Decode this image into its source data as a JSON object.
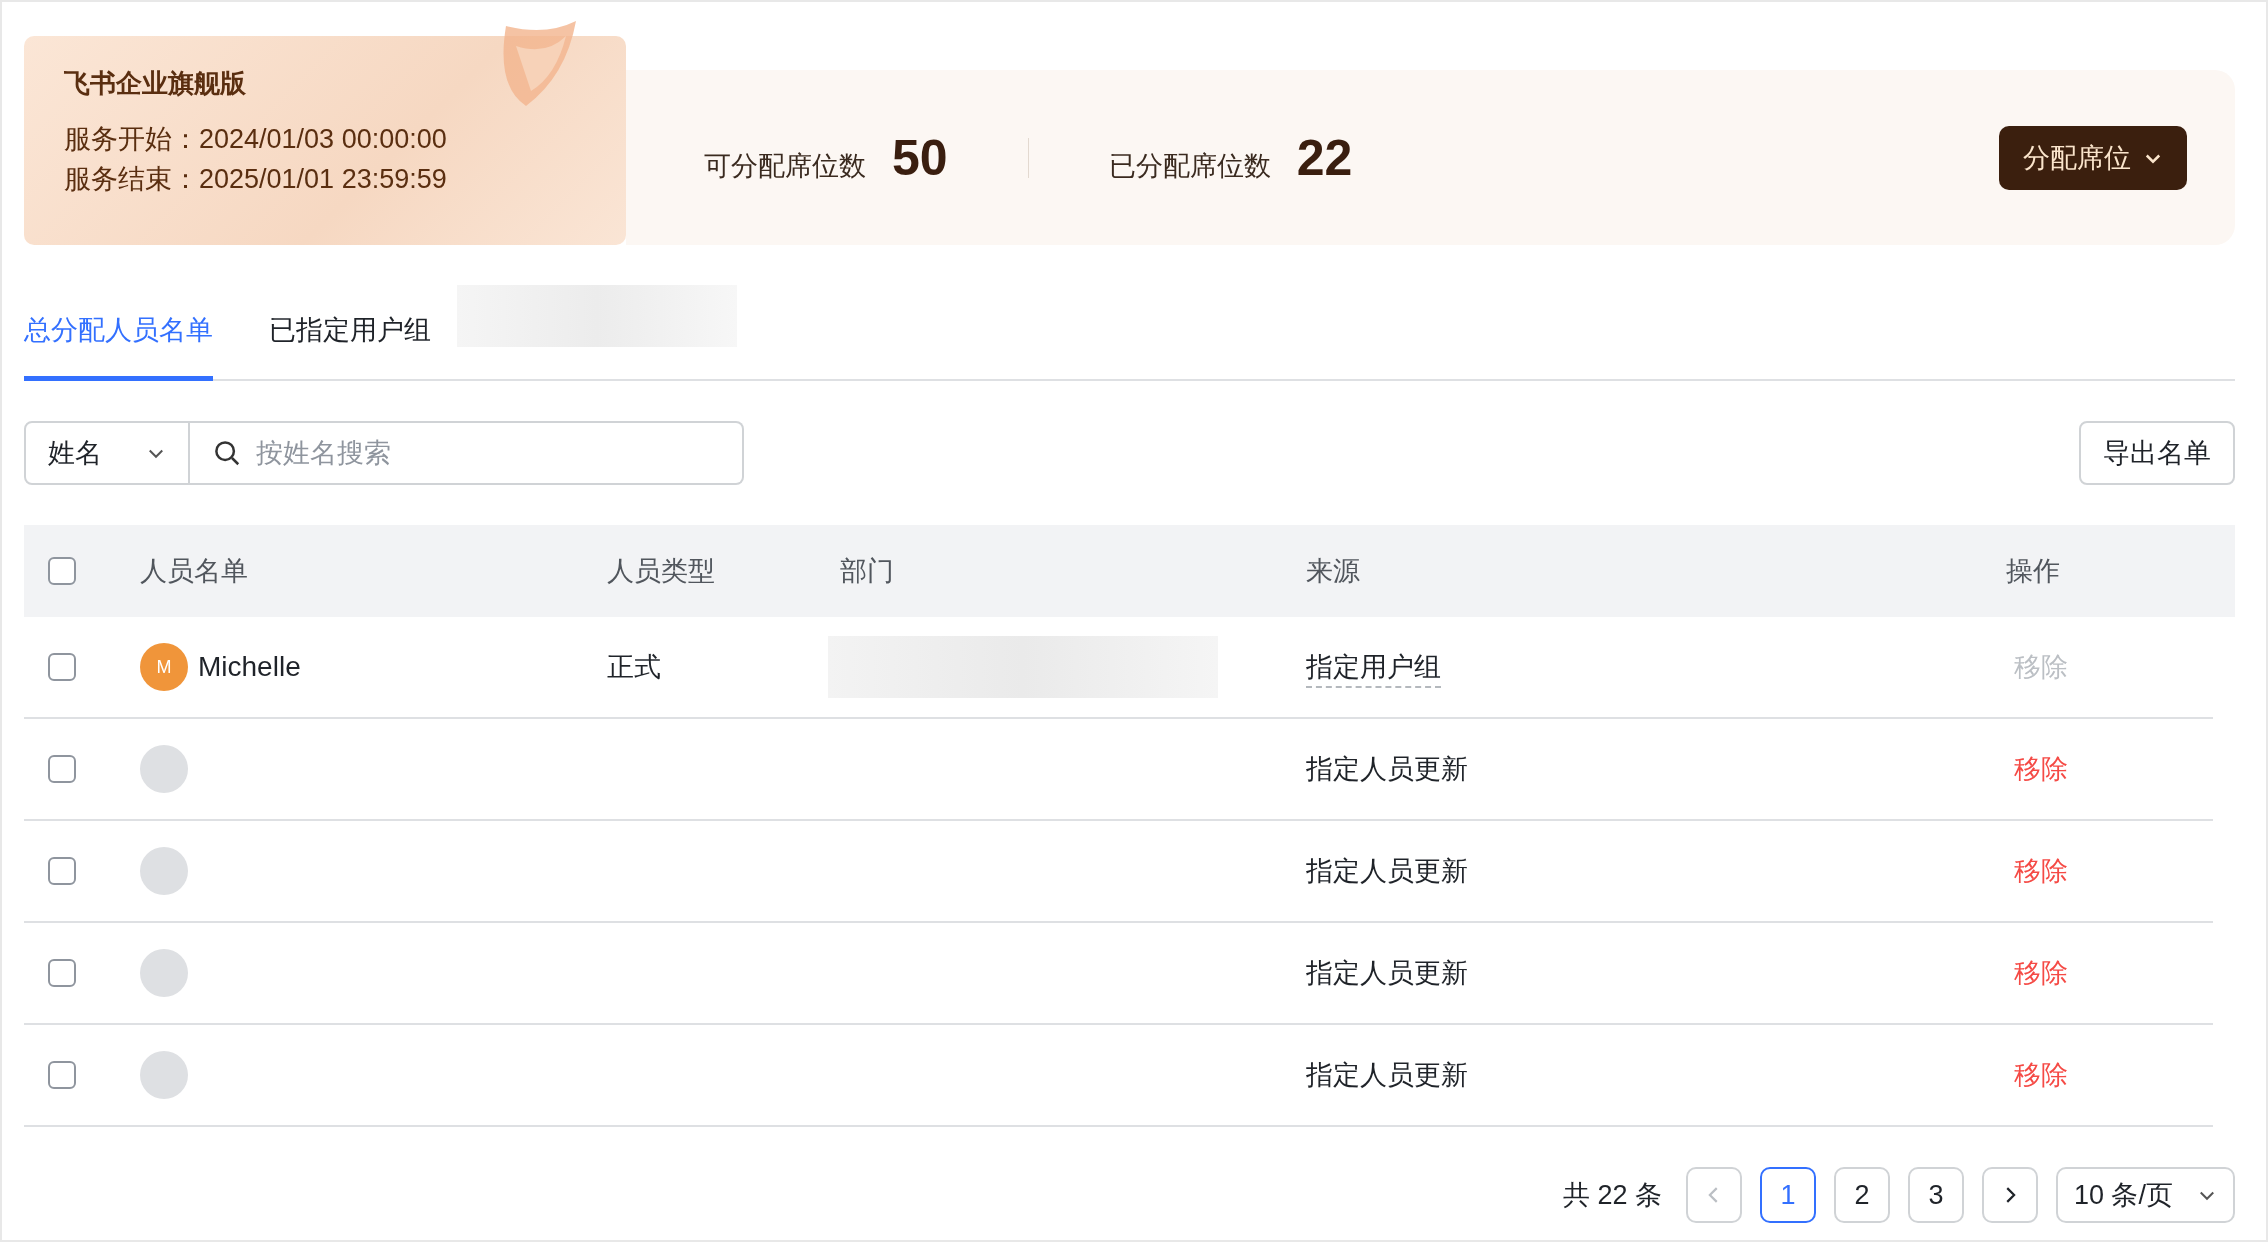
{
  "plan_card": {
    "title": "飞书企业旗舰版",
    "start_label": "服务开始：",
    "start_value": "2024/01/03 00:00:00",
    "end_label": "服务结束：",
    "end_value": "2025/01/01 23:59:59"
  },
  "stats": [
    {
      "label": "可分配席位数",
      "value": "50"
    },
    {
      "label": "已分配席位数",
      "value": "22"
    }
  ],
  "assign_button": {
    "label": "分配席位"
  },
  "tabs": [
    {
      "label": "总分配人员名单",
      "selected": true
    },
    {
      "label": "已指定用户组",
      "selected": false
    }
  ],
  "filter": {
    "field": "姓名",
    "placeholder": "按姓名搜索"
  },
  "export_button": {
    "label": "导出名单"
  },
  "table": {
    "header_checked": false,
    "columns": [
      "人员名单",
      "人员类型",
      "部门",
      "来源",
      "操作"
    ],
    "rows": [
      {
        "checked": false,
        "avatar_initial": "M",
        "name": "Michelle",
        "type": "正式",
        "department_hidden": true,
        "source": "指定用户组",
        "source_link": true,
        "action": "移除",
        "action_disabled": true
      },
      {
        "checked": false,
        "source": "指定人员更新",
        "source_link": false,
        "action": "移除",
        "action_disabled": false
      },
      {
        "checked": false,
        "source": "指定人员更新",
        "source_link": false,
        "action": "移除",
        "action_disabled": false
      },
      {
        "checked": false,
        "source": "指定人员更新",
        "source_link": false,
        "action": "移除",
        "action_disabled": false
      },
      {
        "checked": false,
        "source": "指定人员更新",
        "source_link": false,
        "action": "移除",
        "action_disabled": false
      }
    ]
  },
  "pagination": {
    "total": "共 22 条",
    "prev_disabled": true,
    "pages": [
      {
        "label": "1",
        "selected": true
      },
      {
        "label": "2",
        "selected": false
      },
      {
        "label": "3",
        "selected": false
      }
    ],
    "page_size": "10 条/页"
  }
}
